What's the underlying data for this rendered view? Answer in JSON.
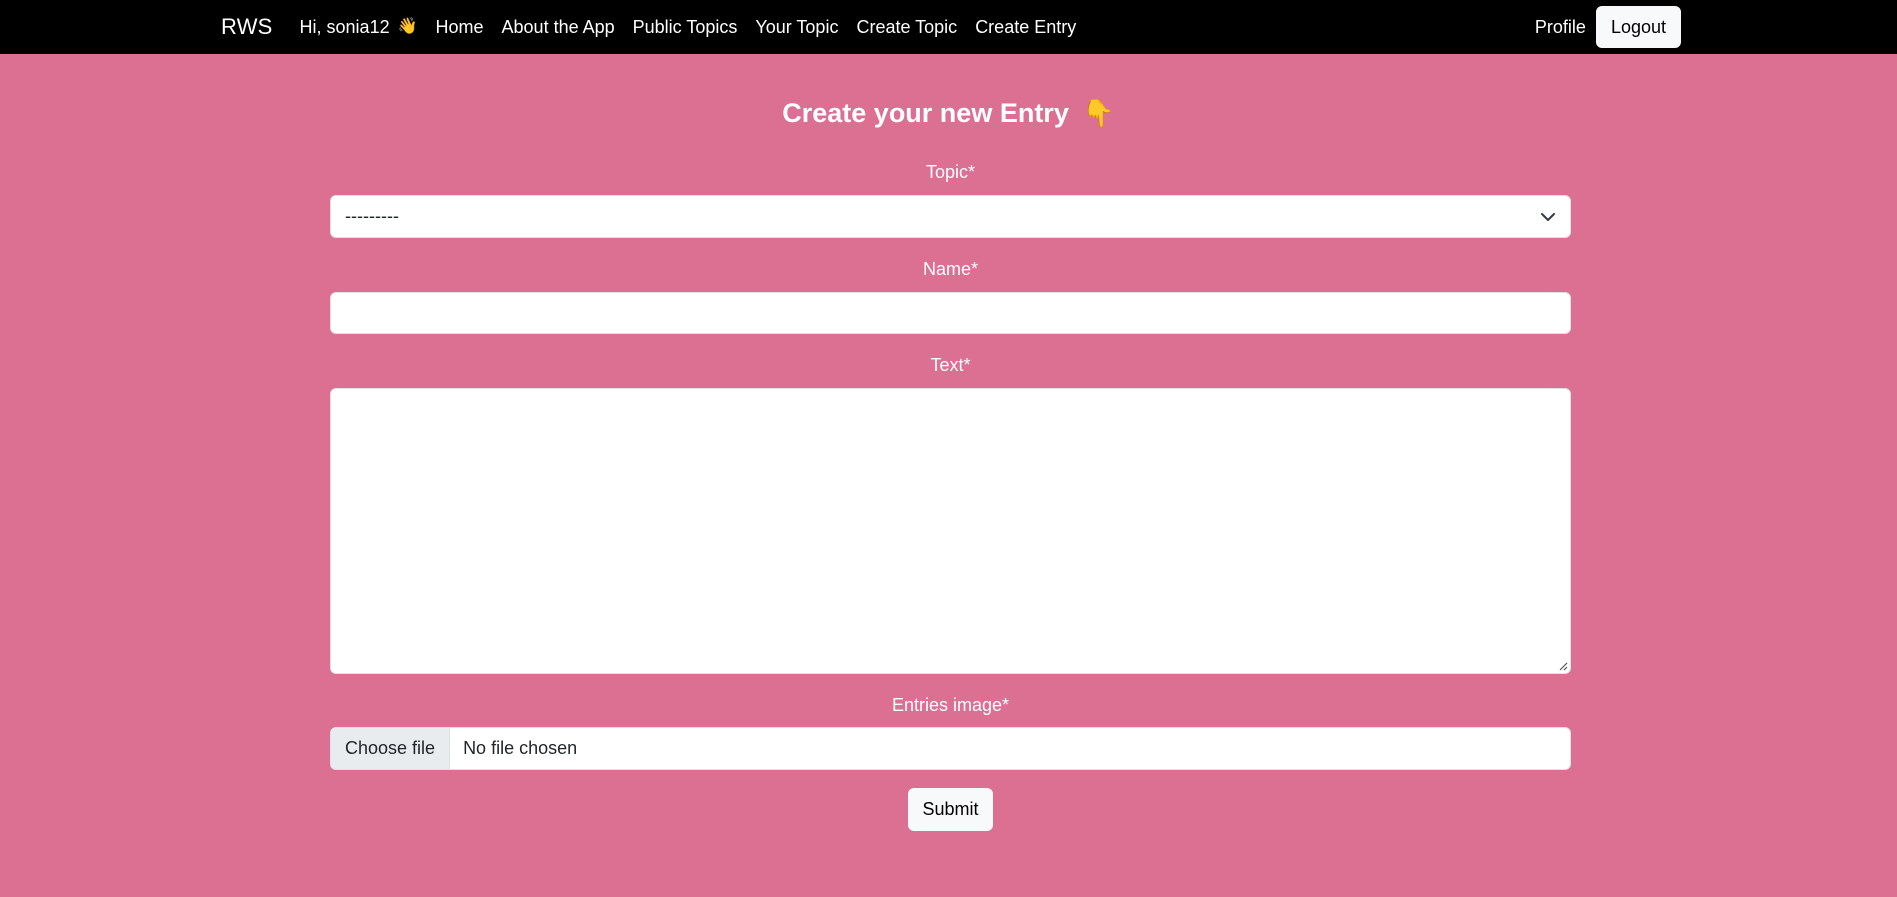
{
  "navbar": {
    "brand": "RWS",
    "greeting": "Hi, sonia12",
    "greeting_emoji": "👋",
    "links": [
      {
        "label": "Home"
      },
      {
        "label": "About the App"
      },
      {
        "label": "Public Topics"
      },
      {
        "label": "Your Topic"
      },
      {
        "label": "Create Topic"
      },
      {
        "label": "Create Entry"
      }
    ],
    "profile_label": "Profile",
    "logout_label": "Logout"
  },
  "page": {
    "title": "Create your new Entry",
    "title_emoji": "👇",
    "background_color": "#db7093"
  },
  "form": {
    "topic_label": "Topic*",
    "topic_selected": "---------",
    "name_label": "Name*",
    "name_value": "",
    "text_label": "Text*",
    "text_value": "",
    "image_label": "Entries image*",
    "file_button_label": "Choose file",
    "file_status": "No file chosen",
    "submit_label": "Submit"
  }
}
